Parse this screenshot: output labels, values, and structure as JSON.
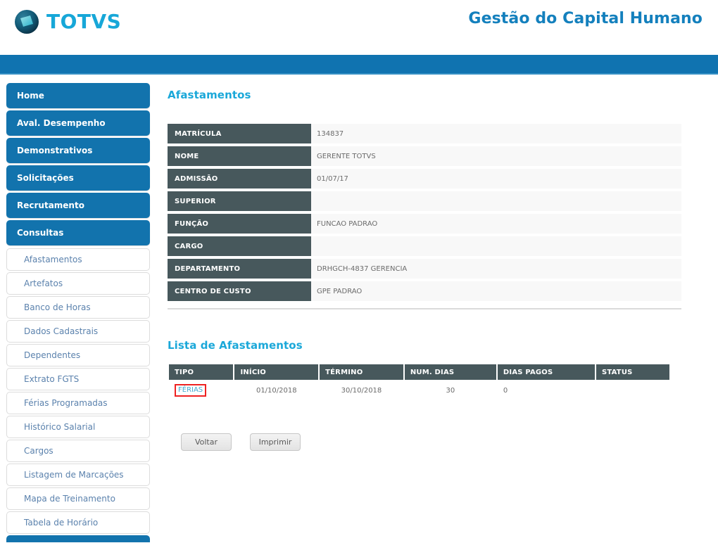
{
  "header": {
    "logo_text": "TOTVS",
    "logo_icon": "totvs-globe-icon",
    "app_title": "Gestão do Capital Humano",
    "brand_color": "#17a7d8",
    "band_color": "#1073b0"
  },
  "sidebar": {
    "main_items": [
      {
        "label": "Home"
      },
      {
        "label": "Aval. Desempenho"
      },
      {
        "label": "Demonstrativos"
      },
      {
        "label": "Solicitações"
      },
      {
        "label": "Recrutamento"
      },
      {
        "label": "Consultas"
      }
    ],
    "sub_items": [
      {
        "label": "Afastamentos"
      },
      {
        "label": "Artefatos"
      },
      {
        "label": "Banco de Horas"
      },
      {
        "label": "Dados Cadastrais"
      },
      {
        "label": "Dependentes"
      },
      {
        "label": "Extrato FGTS"
      },
      {
        "label": "Férias Programadas"
      },
      {
        "label": "Histórico Salarial"
      },
      {
        "label": "Cargos"
      },
      {
        "label": "Listagem de Marcações"
      },
      {
        "label": "Mapa de Treinamento"
      },
      {
        "label": "Tabela de Horário"
      }
    ]
  },
  "main": {
    "page_title": "Afastamentos",
    "employee_info": [
      {
        "label": "MATRÍCULA",
        "value": "134837"
      },
      {
        "label": "NOME",
        "value": "GERENTE TOTVS"
      },
      {
        "label": "ADMISSÃO",
        "value": "01/07/17"
      },
      {
        "label": "SUPERIOR",
        "value": ""
      },
      {
        "label": "FUNÇÃO",
        "value": "FUNCAO PADRAO"
      },
      {
        "label": "CARGO",
        "value": ""
      },
      {
        "label": "DEPARTAMENTO",
        "value": "DRHGCH-4837 GERENCIA"
      },
      {
        "label": "CENTRO DE CUSTO",
        "value": "GPE PADRAO"
      }
    ],
    "list_title": "Lista de Afastamentos",
    "list_columns": [
      "TIPO",
      "INÍCIO",
      "TÉRMINO",
      "NUM. DIAS",
      "DIAS PAGOS",
      "STATUS"
    ],
    "list_rows": [
      {
        "tipo": "FÉRIAS",
        "inicio": "01/10/2018",
        "termino": "30/10/2018",
        "num_dias": "30",
        "dias_pagos": "0",
        "status": ""
      }
    ],
    "highlight_color": "#ee2222",
    "link_color": "#41a8d0",
    "buttons": {
      "back_label": "Voltar",
      "print_label": "Imprimir"
    }
  }
}
